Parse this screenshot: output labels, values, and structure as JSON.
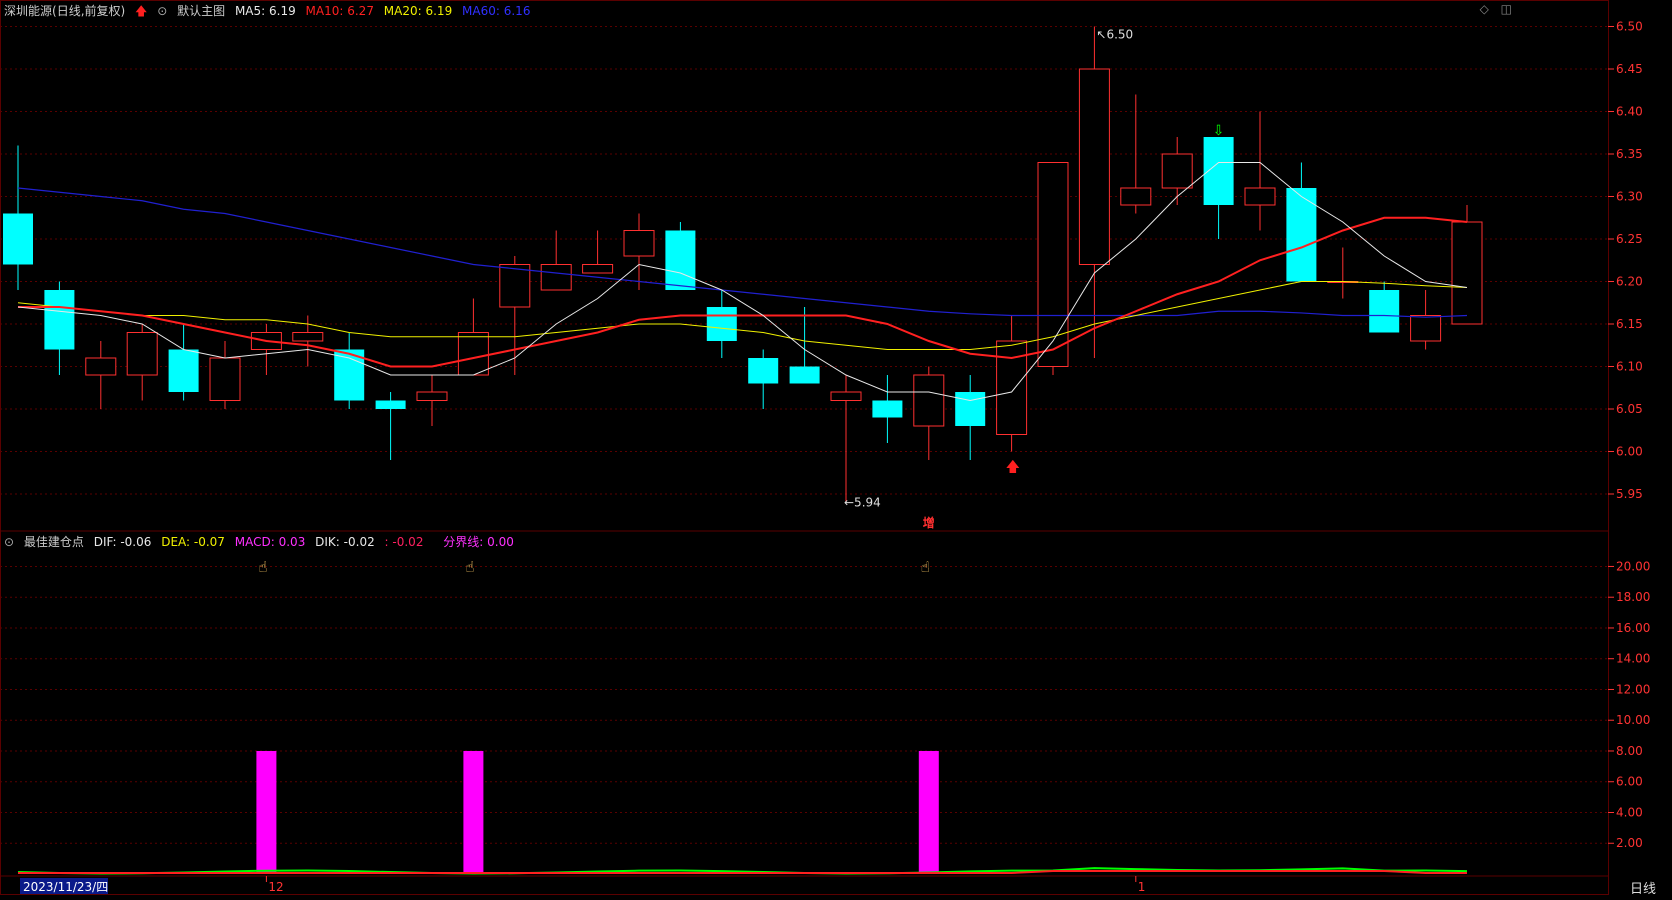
{
  "header": {
    "stock_name": "深圳能源",
    "period": "(日线,前复权)",
    "main_chart_label": "默认主图",
    "ma_labels": [
      {
        "text": "MA5: 6.19",
        "color": "#e8e8e8"
      },
      {
        "text": "MA10: 6.27",
        "color": "#ff2020"
      },
      {
        "text": "MA20: 6.19",
        "color": "#f0f000"
      },
      {
        "text": "MA60: 6.16",
        "color": "#3030ff"
      }
    ]
  },
  "indicator": {
    "name": "最佳建仓点",
    "labels": [
      {
        "text": "DIF: -0.06",
        "color": "#e8e8e8"
      },
      {
        "text": "DEA: -0.07",
        "color": "#f0f000"
      },
      {
        "text": "MACD: 0.03",
        "color": "#ff30ff"
      },
      {
        "text": "DIK: -0.02",
        "color": "#e8e8e8"
      },
      {
        "text": ": -0.02",
        "color": "#ff2060"
      },
      {
        "text": "分界线: 0.00",
        "color": "#ff30ff"
      }
    ]
  },
  "toolbar": {
    "pin_icon": "◇",
    "split_icon": "◫"
  },
  "bottom": {
    "date_label": "2023/11/23/四",
    "month_12": "12",
    "month_1": "1",
    "period_button": "日线"
  },
  "colors": {
    "up": "#ff3030",
    "down": "#00ffff",
    "grid": "#5a0000",
    "axis_text": "#ff3333",
    "ma5": "#e8e8e8",
    "ma10": "#ff2020",
    "ma20": "#f0f000",
    "ma60": "#2020d0",
    "bar": "#ff00ff"
  },
  "chart_data": [
    {
      "type": "candlestick",
      "ylim": [
        5.91,
        6.51
      ],
      "yticks": [
        "5.95",
        "6.00",
        "6.05",
        "6.10",
        "6.15",
        "6.20",
        "6.25",
        "6.30",
        "6.35",
        "6.40",
        "6.45",
        "6.50"
      ],
      "annotations": {
        "high": "6.50",
        "low": "5.94",
        "marker_zeng": "增"
      },
      "candles": [
        {
          "o": 6.28,
          "c": 6.22,
          "h": 6.36,
          "l": 6.19
        },
        {
          "o": 6.19,
          "c": 6.12,
          "h": 6.2,
          "l": 6.09
        },
        {
          "o": 6.09,
          "c": 6.11,
          "h": 6.13,
          "l": 6.05
        },
        {
          "o": 6.09,
          "c": 6.14,
          "h": 6.15,
          "l": 6.06
        },
        {
          "o": 6.12,
          "c": 6.07,
          "h": 6.15,
          "l": 6.06
        },
        {
          "o": 6.06,
          "c": 6.11,
          "h": 6.13,
          "l": 6.05
        },
        {
          "o": 6.12,
          "c": 6.14,
          "h": 6.15,
          "l": 6.09
        },
        {
          "o": 6.13,
          "c": 6.14,
          "h": 6.16,
          "l": 6.1
        },
        {
          "o": 6.12,
          "c": 6.06,
          "h": 6.14,
          "l": 6.05
        },
        {
          "o": 6.06,
          "c": 6.05,
          "h": 6.07,
          "l": 5.99
        },
        {
          "o": 6.06,
          "c": 6.07,
          "h": 6.09,
          "l": 6.03
        },
        {
          "o": 6.09,
          "c": 6.14,
          "h": 6.18,
          "l": 6.09
        },
        {
          "o": 6.17,
          "c": 6.22,
          "h": 6.23,
          "l": 6.09
        },
        {
          "o": 6.19,
          "c": 6.22,
          "h": 6.26,
          "l": 6.19
        },
        {
          "o": 6.21,
          "c": 6.22,
          "h": 6.26,
          "l": 6.21
        },
        {
          "o": 6.23,
          "c": 6.26,
          "h": 6.28,
          "l": 6.19
        },
        {
          "o": 6.26,
          "c": 6.19,
          "h": 6.27,
          "l": 6.19
        },
        {
          "o": 6.17,
          "c": 6.13,
          "h": 6.19,
          "l": 6.11
        },
        {
          "o": 6.11,
          "c": 6.08,
          "h": 6.12,
          "l": 6.05
        },
        {
          "o": 6.1,
          "c": 6.08,
          "h": 6.17,
          "l": 6.08
        },
        {
          "o": 6.06,
          "c": 6.07,
          "h": 6.09,
          "l": 5.94
        },
        {
          "o": 6.06,
          "c": 6.04,
          "h": 6.09,
          "l": 6.01
        },
        {
          "o": 6.03,
          "c": 6.09,
          "h": 6.1,
          "l": 5.99
        },
        {
          "o": 6.07,
          "c": 6.03,
          "h": 6.09,
          "l": 5.99
        },
        {
          "o": 6.02,
          "c": 6.13,
          "h": 6.16,
          "l": 6.0
        },
        {
          "o": 6.1,
          "c": 6.34,
          "h": 6.34,
          "l": 6.09
        },
        {
          "o": 6.22,
          "c": 6.45,
          "h": 6.5,
          "l": 6.11
        },
        {
          "o": 6.29,
          "c": 6.31,
          "h": 6.42,
          "l": 6.28
        },
        {
          "o": 6.31,
          "c": 6.35,
          "h": 6.37,
          "l": 6.29
        },
        {
          "o": 6.37,
          "c": 6.29,
          "h": 6.37,
          "l": 6.25
        },
        {
          "o": 6.29,
          "c": 6.31,
          "h": 6.4,
          "l": 6.26
        },
        {
          "o": 6.31,
          "c": 6.2,
          "h": 6.34,
          "l": 6.2
        },
        {
          "o": 6.2,
          "c": 6.2,
          "h": 6.24,
          "l": 6.18
        },
        {
          "o": 6.19,
          "c": 6.14,
          "h": 6.2,
          "l": 6.14
        },
        {
          "o": 6.13,
          "c": 6.16,
          "h": 6.19,
          "l": 6.12
        },
        {
          "o": 6.15,
          "c": 6.27,
          "h": 6.29,
          "l": 6.15
        }
      ],
      "ma5": [
        6.17,
        6.165,
        6.16,
        6.15,
        6.12,
        6.11,
        6.115,
        6.12,
        6.11,
        6.09,
        6.09,
        6.09,
        6.11,
        6.15,
        6.18,
        6.22,
        6.21,
        6.19,
        6.16,
        6.12,
        6.09,
        6.07,
        6.07,
        6.06,
        6.07,
        6.13,
        6.21,
        6.25,
        6.3,
        6.34,
        6.34,
        6.3,
        6.27,
        6.23,
        6.2,
        6.193
      ],
      "ma10": [
        6.17,
        6.17,
        6.165,
        6.16,
        6.15,
        6.14,
        6.13,
        6.125,
        6.115,
        6.1,
        6.1,
        6.11,
        6.12,
        6.13,
        6.14,
        6.155,
        6.16,
        6.16,
        6.16,
        6.16,
        6.16,
        6.15,
        6.13,
        6.115,
        6.11,
        6.12,
        6.145,
        6.165,
        6.185,
        6.2,
        6.225,
        6.24,
        6.26,
        6.275,
        6.275,
        6.27
      ],
      "ma20": [
        6.175,
        6.17,
        6.165,
        6.16,
        6.16,
        6.155,
        6.155,
        6.15,
        6.14,
        6.135,
        6.135,
        6.135,
        6.135,
        6.14,
        6.145,
        6.15,
        6.15,
        6.145,
        6.14,
        6.13,
        6.125,
        6.12,
        6.12,
        6.12,
        6.125,
        6.135,
        6.15,
        6.16,
        6.17,
        6.18,
        6.19,
        6.2,
        6.2,
        6.198,
        6.195,
        6.193
      ],
      "ma60": [
        6.31,
        6.305,
        6.3,
        6.295,
        6.285,
        6.28,
        6.27,
        6.26,
        6.25,
        6.24,
        6.23,
        6.22,
        6.215,
        6.21,
        6.205,
        6.2,
        6.195,
        6.19,
        6.185,
        6.18,
        6.175,
        6.17,
        6.165,
        6.162,
        6.16,
        6.16,
        6.16,
        6.16,
        6.16,
        6.165,
        6.165,
        6.163,
        6.16,
        6.16,
        6.158,
        6.16
      ],
      "signals": {
        "buy": [
          24
        ],
        "sell": [
          29
        ],
        "zeng": [
          22
        ]
      }
    },
    {
      "type": "bar",
      "ylim": [
        0,
        21.2
      ],
      "yticks": [
        "2.00",
        "4.00",
        "6.00",
        "8.00",
        "10.00",
        "12.00",
        "14.00",
        "16.00",
        "18.00",
        "20.00"
      ],
      "bars": [
        {
          "index": 6,
          "value": 8
        },
        {
          "index": 11,
          "value": 8
        },
        {
          "index": 22,
          "value": 8
        }
      ],
      "hand_icons": [
        6,
        11,
        22
      ]
    }
  ]
}
